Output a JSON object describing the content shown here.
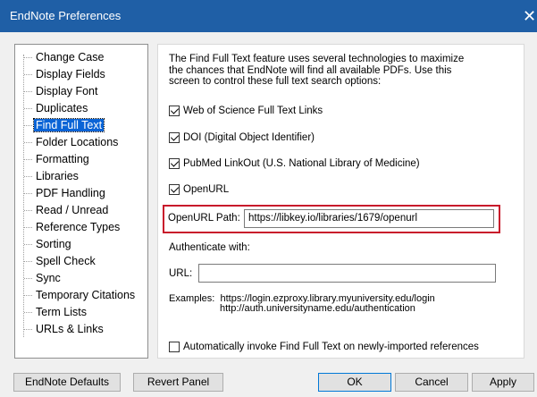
{
  "window": {
    "title": "EndNote Preferences",
    "close_glyph": "✕"
  },
  "tree": {
    "items": [
      {
        "label": "Change Case",
        "selected": false
      },
      {
        "label": "Display Fields",
        "selected": false
      },
      {
        "label": "Display Font",
        "selected": false
      },
      {
        "label": "Duplicates",
        "selected": false
      },
      {
        "label": "Find Full Text",
        "selected": true
      },
      {
        "label": "Folder Locations",
        "selected": false
      },
      {
        "label": "Formatting",
        "selected": false
      },
      {
        "label": "Libraries",
        "selected": false
      },
      {
        "label": "PDF Handling",
        "selected": false
      },
      {
        "label": "Read / Unread",
        "selected": false
      },
      {
        "label": "Reference Types",
        "selected": false
      },
      {
        "label": "Sorting",
        "selected": false
      },
      {
        "label": "Spell Check",
        "selected": false
      },
      {
        "label": "Sync",
        "selected": false
      },
      {
        "label": "Temporary Citations",
        "selected": false
      },
      {
        "label": "Term Lists",
        "selected": false
      },
      {
        "label": "URLs & Links",
        "selected": false
      }
    ]
  },
  "panel": {
    "intro": "The Find Full Text feature uses several technologies to maximize the chances that EndNote will find all available PDFs. Use this screen to control these full text search options:",
    "checkboxes": [
      {
        "label": "Web of Science Full Text Links",
        "checked": true
      },
      {
        "label": "DOI (Digital Object Identifier)",
        "checked": true
      },
      {
        "label": "PubMed LinkOut (U.S. National Library of Medicine)",
        "checked": true
      },
      {
        "label": "OpenURL",
        "checked": true
      }
    ],
    "openurl_path_label": "OpenURL Path:",
    "openurl_path_value": "https://libkey.io/libraries/1679/openurl",
    "authenticate_label": "Authenticate with:",
    "url_label": "URL:",
    "url_value": "",
    "examples_label": "Examples:",
    "examples_line1": "https://login.ezproxy.library.myuniversity.edu/login",
    "examples_line2": "http://auth.universityname.edu/authentication",
    "auto_invoke": {
      "label": "Automatically invoke Find Full Text on newly-imported references",
      "checked": false
    }
  },
  "buttons": {
    "defaults": "EndNote Defaults",
    "revert": "Revert Panel",
    "ok": "OK",
    "cancel": "Cancel",
    "apply": "Apply"
  },
  "colors": {
    "titlebar": "#1f5fa6",
    "selection": "#0a64d6",
    "highlight_border": "#c8192b"
  }
}
